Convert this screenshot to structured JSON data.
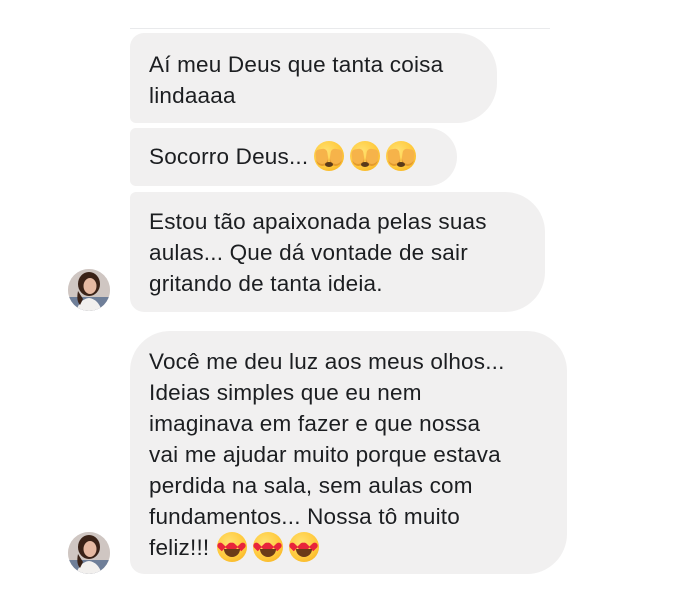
{
  "messages": [
    {
      "lines": [
        "Aí meu Deus que tanta coisa",
        "lindaaaa"
      ]
    },
    {
      "text": "Socorro Deus...",
      "emojis": [
        "face-covering-eyes-icon",
        "face-covering-eyes-icon",
        "face-covering-eyes-icon"
      ]
    },
    {
      "lines": [
        "Estou tão apaixonada pelas suas",
        "aulas... Que dá vontade de sair",
        "gritando de tanta ideia."
      ]
    },
    {
      "lines": [
        "Você me deu luz aos meus olhos...",
        "Ideias simples que eu nem",
        "imaginava em fazer e que nossa",
        "vai me ajudar muito porque estava",
        "perdida na sala, sem aulas com",
        "fundamentos... Nossa tô muito"
      ],
      "last_line": "feliz!!!",
      "emojis": [
        "heart-eyes-icon",
        "heart-eyes-icon",
        "heart-eyes-icon"
      ]
    }
  ],
  "colors": {
    "bubble_background": "#f1f0f0",
    "text": "#1c1e21",
    "page_background": "#ffffff"
  }
}
